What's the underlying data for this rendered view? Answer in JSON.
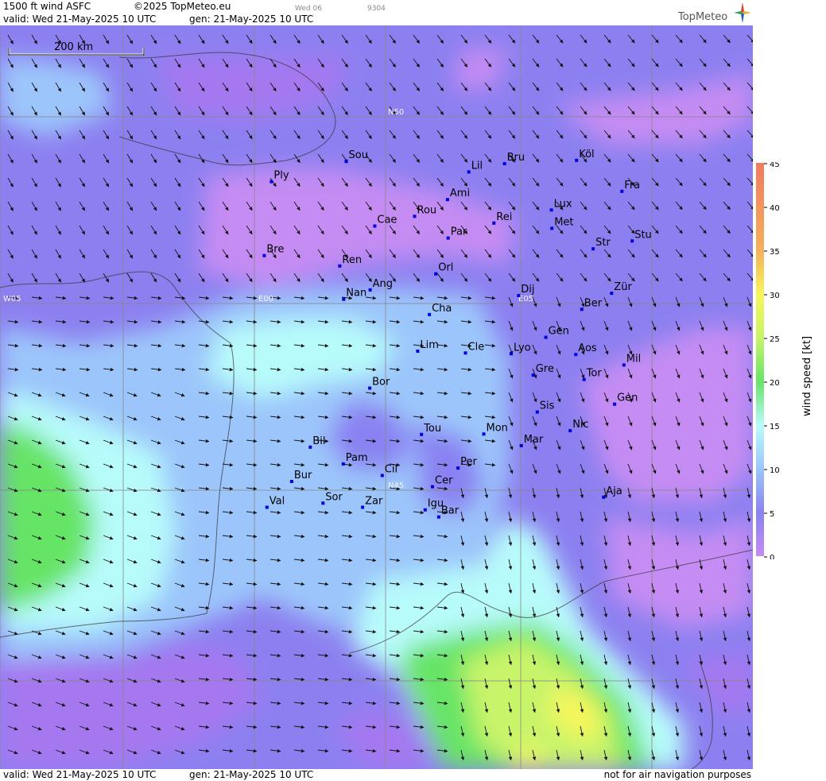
{
  "header": {
    "product": "1500 ft wind ASFC",
    "copyright": "©2025 TopMeteo.eu",
    "day_code": "Wed 06",
    "map_code": "9304",
    "valid": "valid:  Wed  21-May-2025  10 UTC",
    "gen": "gen:  21-May-2025  10 UTC"
  },
  "logo": {
    "text": "TopMeteo",
    "icon": "compass-star-icon"
  },
  "footer": {
    "valid": "valid:  Wed  21-May-2025  10 UTC",
    "gen": "gen:  21-May-2025  10 UTC",
    "disclaimer": "not for air navigation purposes"
  },
  "scale": {
    "label": "200 km"
  },
  "grid_labels": [
    "N50",
    "N45",
    "W05",
    "E00",
    "E05"
  ],
  "colors": {
    "calm_violet": "#a678f0",
    "light_violet": "#c58cf3",
    "blue_violet": "#8a82f2",
    "light_blue": "#9cc6fb",
    "cyan": "#b8fbfb",
    "green": "#66e466",
    "yellow_green": "#c8f46a",
    "yellow": "#f6f65a",
    "orange": "#f5b05a",
    "red": "#f27a5e"
  },
  "legend": {
    "title": "wind  speed  [kt]",
    "ticks": [
      "45",
      "40",
      "35",
      "30",
      "25",
      "20",
      "15",
      "10",
      "5",
      "0"
    ]
  },
  "cities": [
    {
      "name": "Sou",
      "lon": -1.4,
      "lat": 50.91
    },
    {
      "name": "Bru",
      "lon": 4.35,
      "lat": 50.85
    },
    {
      "name": "Köl",
      "lon": 6.96,
      "lat": 50.94
    },
    {
      "name": "Ply",
      "lon": -4.14,
      "lat": 50.37
    },
    {
      "name": "Lil",
      "lon": 3.06,
      "lat": 50.63
    },
    {
      "name": "Ami",
      "lon": 2.3,
      "lat": 49.89
    },
    {
      "name": "Fra",
      "lon": 8.68,
      "lat": 50.11
    },
    {
      "name": "Lux",
      "lon": 6.13,
      "lat": 49.61
    },
    {
      "name": "Rou",
      "lon": 1.1,
      "lat": 49.44
    },
    {
      "name": "Cae",
      "lon": -0.37,
      "lat": 49.18
    },
    {
      "name": "Rei",
      "lon": 4.03,
      "lat": 49.26
    },
    {
      "name": "Met",
      "lon": 6.18,
      "lat": 49.12
    },
    {
      "name": "Par",
      "lon": 2.35,
      "lat": 48.86
    },
    {
      "name": "Stu",
      "lon": 9.18,
      "lat": 48.78
    },
    {
      "name": "Bre",
      "lon": -4.49,
      "lat": 48.39
    },
    {
      "name": "Str",
      "lon": 7.75,
      "lat": 48.57
    },
    {
      "name": "Ren",
      "lon": -1.68,
      "lat": 48.11
    },
    {
      "name": "Orl",
      "lon": 1.91,
      "lat": 47.9
    },
    {
      "name": "Ang",
      "lon": -0.55,
      "lat": 47.47
    },
    {
      "name": "Dij",
      "lon": 5.04,
      "lat": 47.32
    },
    {
      "name": "Zür",
      "lon": 8.54,
      "lat": 47.38
    },
    {
      "name": "Nan",
      "lon": -1.55,
      "lat": 47.22
    },
    {
      "name": "Ber",
      "lon": 7.45,
      "lat": 46.95
    },
    {
      "name": "Cha",
      "lon": 1.69,
      "lat": 46.81
    },
    {
      "name": "Gen",
      "lon": 6.14,
      "lat": 46.2
    },
    {
      "name": "Lim",
      "lon": 1.26,
      "lat": 45.83
    },
    {
      "name": "Cle",
      "lon": 3.09,
      "lat": 45.78
    },
    {
      "name": "Lyo",
      "lon": 4.84,
      "lat": 45.76
    },
    {
      "name": "Aos",
      "lon": 7.32,
      "lat": 45.74
    },
    {
      "name": "Mil",
      "lon": 9.19,
      "lat": 45.46
    },
    {
      "name": "Gre",
      "lon": 5.72,
      "lat": 45.19
    },
    {
      "name": "Tor",
      "lon": 7.69,
      "lat": 45.07
    },
    {
      "name": "Bor",
      "lon": -0.58,
      "lat": 44.84
    },
    {
      "name": "Sis",
      "lon": 5.94,
      "lat": 44.2
    },
    {
      "name": "Gen",
      "lon": 8.93,
      "lat": 44.41
    },
    {
      "name": "Nic",
      "lon": 7.26,
      "lat": 43.7
    },
    {
      "name": "Tou",
      "lon": 1.44,
      "lat": 43.6
    },
    {
      "name": "Mon",
      "lon": 3.88,
      "lat": 43.61
    },
    {
      "name": "Mar",
      "lon": 5.37,
      "lat": 43.3
    },
    {
      "name": "Bil",
      "lon": -2.93,
      "lat": 43.26
    },
    {
      "name": "Pam",
      "lon": -1.64,
      "lat": 42.81
    },
    {
      "name": "Cil",
      "lon": -0.1,
      "lat": 42.5
    },
    {
      "name": "Per",
      "lon": 2.9,
      "lat": 42.7
    },
    {
      "name": "Bur",
      "lon": -3.7,
      "lat": 42.34
    },
    {
      "name": "Cer",
      "lon": 1.9,
      "lat": 42.2
    },
    {
      "name": "Aja",
      "lon": 8.74,
      "lat": 41.92
    },
    {
      "name": "Sor",
      "lon": -2.47,
      "lat": 41.76
    },
    {
      "name": "Val",
      "lon": -4.72,
      "lat": 41.65
    },
    {
      "name": "Zar",
      "lon": -0.89,
      "lat": 41.65
    },
    {
      "name": "Igu",
      "lon": 1.62,
      "lat": 41.58
    },
    {
      "name": "Bar",
      "lon": 2.17,
      "lat": 41.39
    }
  ]
}
